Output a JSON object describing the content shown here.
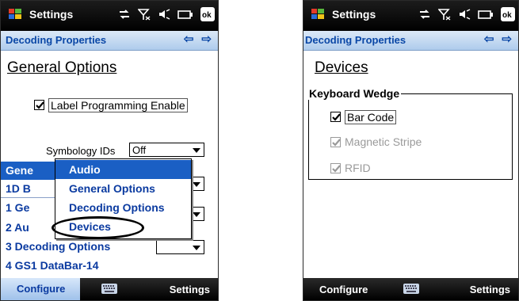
{
  "left": {
    "status": {
      "title": "Settings"
    },
    "titlebar": {
      "title": "Decoding Properties"
    },
    "heading": "General Options",
    "label_programming": {
      "label": "Label Programming Enable",
      "checked": true
    },
    "symbology": {
      "label": "Symbology IDs",
      "value": "Off"
    },
    "list_items": [
      "Gene",
      "1D B",
      "1 Ge",
      "2 Au",
      "3 Decoding Options",
      "4 GS1 DataBar-14"
    ],
    "popup_items": [
      "Audio",
      "General Options",
      "Decoding Options",
      "Devices"
    ],
    "bottom": {
      "left": "Configure",
      "right": "Settings"
    }
  },
  "right": {
    "status": {
      "title": "Settings"
    },
    "titlebar": {
      "title": "Decoding Properties"
    },
    "heading": "Devices",
    "group": {
      "legend": "Keyboard Wedge",
      "items": [
        {
          "label": "Bar Code",
          "checked": true,
          "enabled": true
        },
        {
          "label": "Magnetic Stripe",
          "checked": true,
          "enabled": false
        },
        {
          "label": "RFID",
          "checked": true,
          "enabled": false
        }
      ]
    },
    "bottom": {
      "left": "Configure",
      "right": "Settings"
    }
  },
  "colors": {
    "accent": "#1a5fc4",
    "link_text": "#0a3aa0",
    "titlebar_text": "#0a47a6",
    "disabled": "#9a9a9a"
  },
  "icons": [
    "windows-logo-icon",
    "connectivity-icon",
    "no-signal-icon",
    "volume-icon",
    "battery-icon",
    "ok-icon",
    "back-arrow-icon",
    "forward-arrow-icon",
    "keyboard-icon",
    "checkmark-icon",
    "dropdown-arrow-icon"
  ]
}
